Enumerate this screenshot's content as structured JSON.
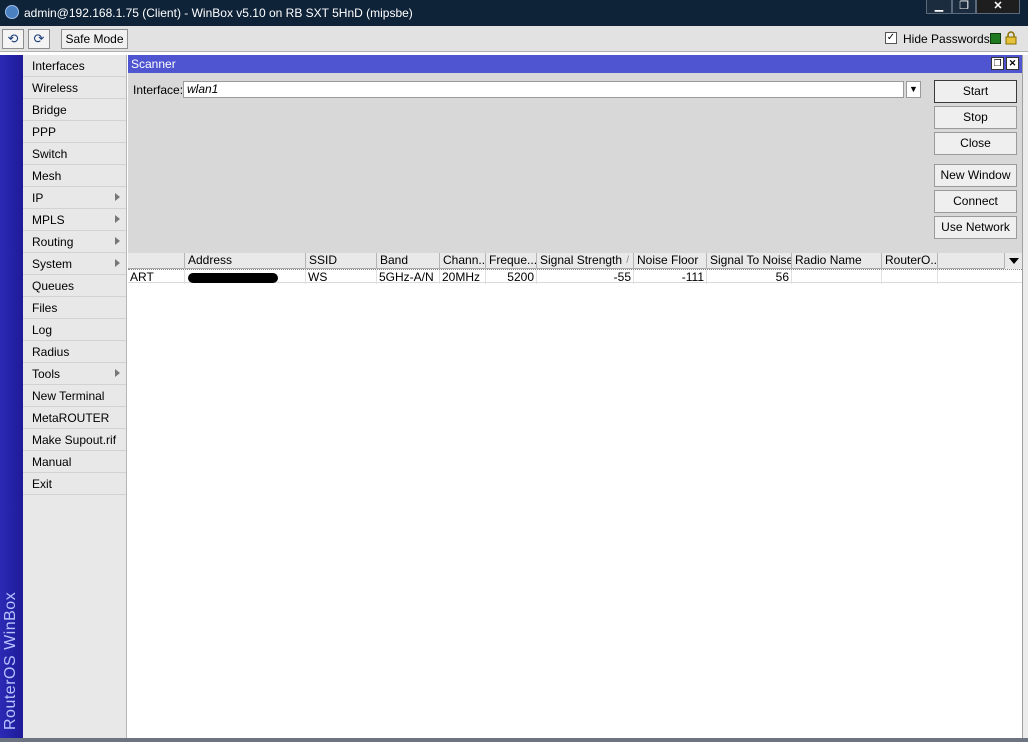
{
  "window": {
    "title": "admin@192.168.1.75 (Client) - WinBox v5.10 on RB SXT 5HnD (mipsbe)",
    "controls": {
      "minimize": "▁",
      "maximize": "❐",
      "close": "✕"
    }
  },
  "toolbar": {
    "undo_icon": "undo-icon",
    "redo_icon": "redo-icon",
    "safe_mode_label": "Safe Mode",
    "hide_passwords_label": "Hide Passwords",
    "hide_passwords_checked": "✓"
  },
  "brand": "RouterOS WinBox",
  "sidebar": {
    "items": [
      {
        "label": "Interfaces"
      },
      {
        "label": "Wireless"
      },
      {
        "label": "Bridge"
      },
      {
        "label": "PPP"
      },
      {
        "label": "Switch"
      },
      {
        "label": "Mesh"
      },
      {
        "label": "IP"
      },
      {
        "label": "MPLS"
      },
      {
        "label": "Routing"
      },
      {
        "label": "System"
      },
      {
        "label": "Queues"
      },
      {
        "label": "Files"
      },
      {
        "label": "Log"
      },
      {
        "label": "Radius"
      },
      {
        "label": "Tools"
      },
      {
        "label": "New Terminal"
      },
      {
        "label": "MetaROUTER"
      },
      {
        "label": "Make Supout.rif"
      },
      {
        "label": "Manual"
      },
      {
        "label": "Exit"
      }
    ]
  },
  "scanner": {
    "title": "Scanner",
    "interface_label": "Interface:",
    "interface_value": "wlan1",
    "buttons": {
      "start": "Start",
      "stop": "Stop",
      "close": "Close",
      "new_window": "New Window",
      "connect": "Connect",
      "use_network": "Use Network"
    },
    "columns": [
      "",
      "Address",
      "SSID",
      "Band",
      "Chann...",
      "Freque...",
      "Signal Strength",
      "Noise Floor",
      "Signal To Noise",
      "Radio Name",
      "RouterO..."
    ],
    "sort_indicator": "/",
    "row": {
      "flags": "ART",
      "address": "",
      "ssid": "WS",
      "band": "5GHz-A/N",
      "channel_width": "20MHz",
      "frequency": "5200",
      "signal_strength": "-55",
      "noise_floor": "-111",
      "signal_to_noise": "56",
      "radio_name": "",
      "routeros": ""
    }
  },
  "colors": {
    "titlebar": "#0e2238",
    "brand_bar": "#2b2ab5",
    "scanner_header": "#4f54d1"
  }
}
